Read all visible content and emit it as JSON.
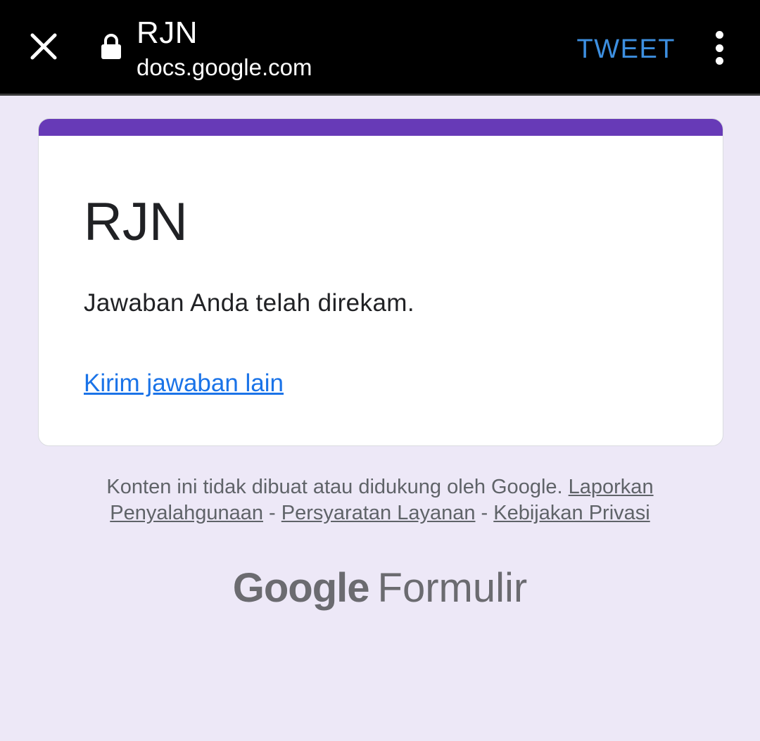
{
  "browser": {
    "title": "RJN",
    "url": "docs.google.com",
    "tweet_label": "TWEET",
    "accent_color": "#3d8fe0"
  },
  "card": {
    "accent_color": "#673ab7",
    "title": "RJN",
    "message": "Jawaban Anda telah direkam.",
    "submit_again_label": "Kirim jawaban lain"
  },
  "footer": {
    "disclaimer": "Konten ini tidak dibuat atau didukung oleh Google.",
    "report_abuse": "Laporkan Penyalahgunaan",
    "separator": "-",
    "terms": "Persyaratan Layanan",
    "privacy": "Kebijakan Privasi"
  },
  "brand": {
    "google": "Google",
    "product": "Formulir"
  }
}
